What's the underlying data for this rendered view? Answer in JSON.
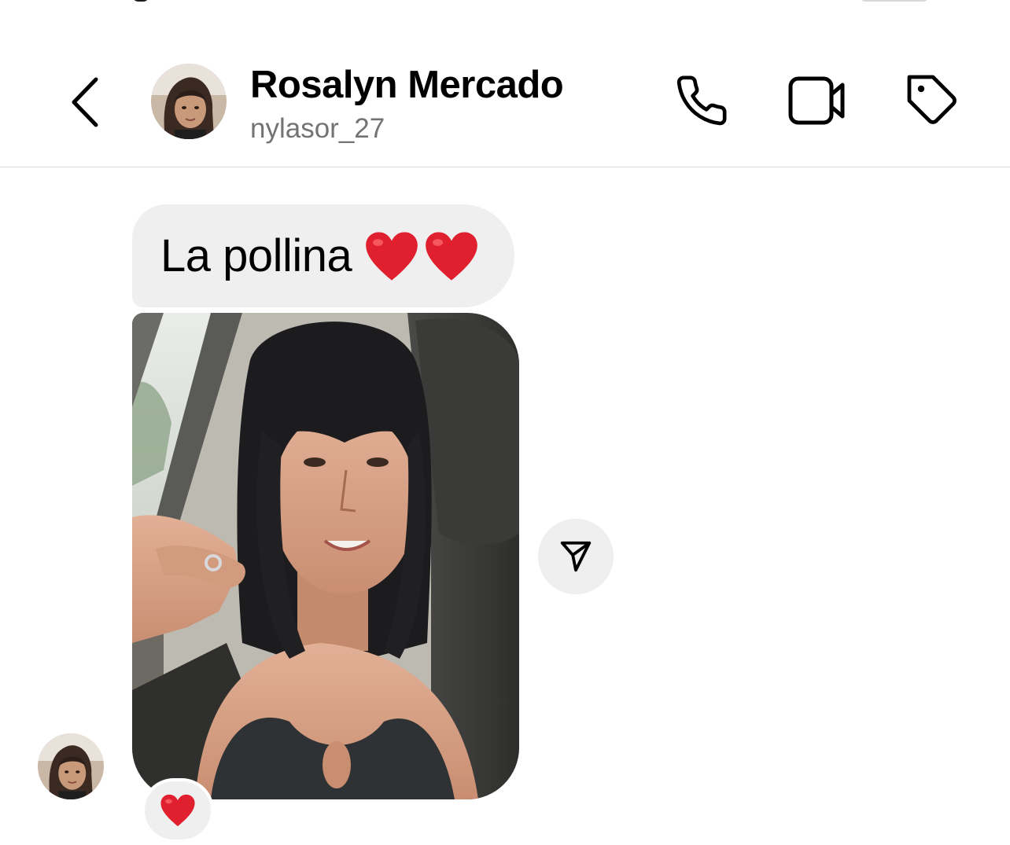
{
  "header": {
    "name": "Rosalyn Mercado",
    "username": "nylasor_27",
    "icons": {
      "back": "chevron-left-icon",
      "call": "phone-icon",
      "video": "video-camera-icon",
      "tag": "tag-icon"
    }
  },
  "thread": {
    "messages": [
      {
        "type": "text",
        "text": "La pollina",
        "emoji": [
          "heart",
          "heart"
        ]
      },
      {
        "type": "photo",
        "alt": "selfie"
      }
    ],
    "reaction": "heart",
    "share_icon": "send-icon"
  },
  "colors": {
    "bubble_bg": "#efefef",
    "heart": "#e0202e",
    "username": "#737373",
    "divider": "#dbdbdb"
  }
}
